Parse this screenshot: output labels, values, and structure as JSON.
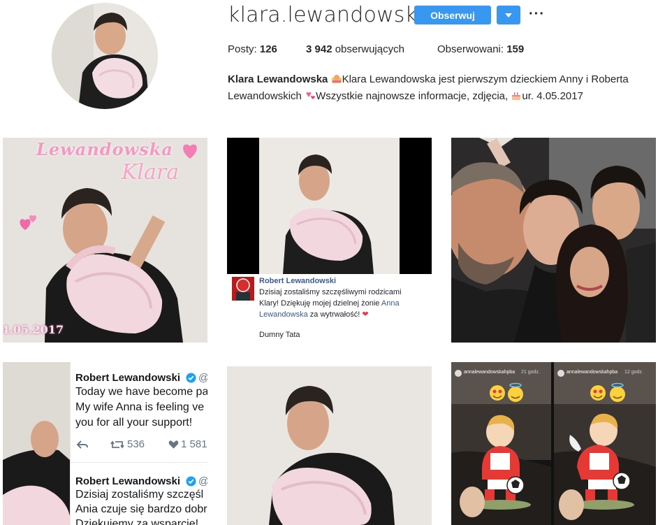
{
  "profile": {
    "username": "klara.lewandowska",
    "follow_label": "Obserwuj",
    "posts_label": "Posty:",
    "posts_count": "126",
    "followers_count": "3 942",
    "followers_label": "obserwujących",
    "following_label": "Obserwowani:",
    "following_count": "159",
    "bio_name": "Klara Lewandowska",
    "bio_line1": "Klara Lewandowska jest pierwszym dzieckiem Anny i Roberta",
    "bio_line2a": "Lewandowskich",
    "bio_line2b": "Wszystkie najnowsze informacje, zdjęcia",
    "bio_line2c": "ur. 4.05.2017"
  },
  "posts": {
    "p1": {
      "title_top": "Lewandowska",
      "title_bottom": "Klara",
      "date": "4.05.2017"
    },
    "p2": {
      "author": "Robert Lewandowski",
      "line1": "Dzisiaj zostaliśmy szczęśliwymi rodzicami",
      "line2a": "Klary! Dziękuję mojej dzielnej żonie",
      "line2b": "Anna",
      "line3a": "Lewandowska",
      "line3b": "za wytrwałość!",
      "sign": "Dumny Tata"
    },
    "p4": {
      "tweet1_author": "Robert Lewandowski",
      "tweet1_handle": "@",
      "tweet1_line1": "Today we have become pa",
      "tweet1_line2": "My wife Anna is feeling ve",
      "tweet1_line3": "you for all your support!",
      "retweets": "536",
      "likes": "1 581",
      "tweet2_author": "Robert Lewandowski",
      "tweet2_handle": "@",
      "tweet2_line1": "Dzisiaj zostaliśmy szczęśl",
      "tweet2_line2": "Ania czuje się bardzo dobr",
      "tweet2_line3": "Dziękujemy za wsparcie!"
    },
    "p6": {
      "story_user_left": "annalewandowskahpba",
      "story_time_left": "21 godz.",
      "story_user_right": "annalewandowskahpba",
      "story_time_right": "12 godz."
    }
  },
  "colors": {
    "accent": "#3897f0",
    "pink": "#f39ac2",
    "twitter_blue": "#1da1f2"
  },
  "icons": [
    "chevron-down-icon",
    "more-options-icon",
    "verified-icon",
    "reply-icon",
    "retweet-icon",
    "like-icon",
    "heart-icon"
  ]
}
